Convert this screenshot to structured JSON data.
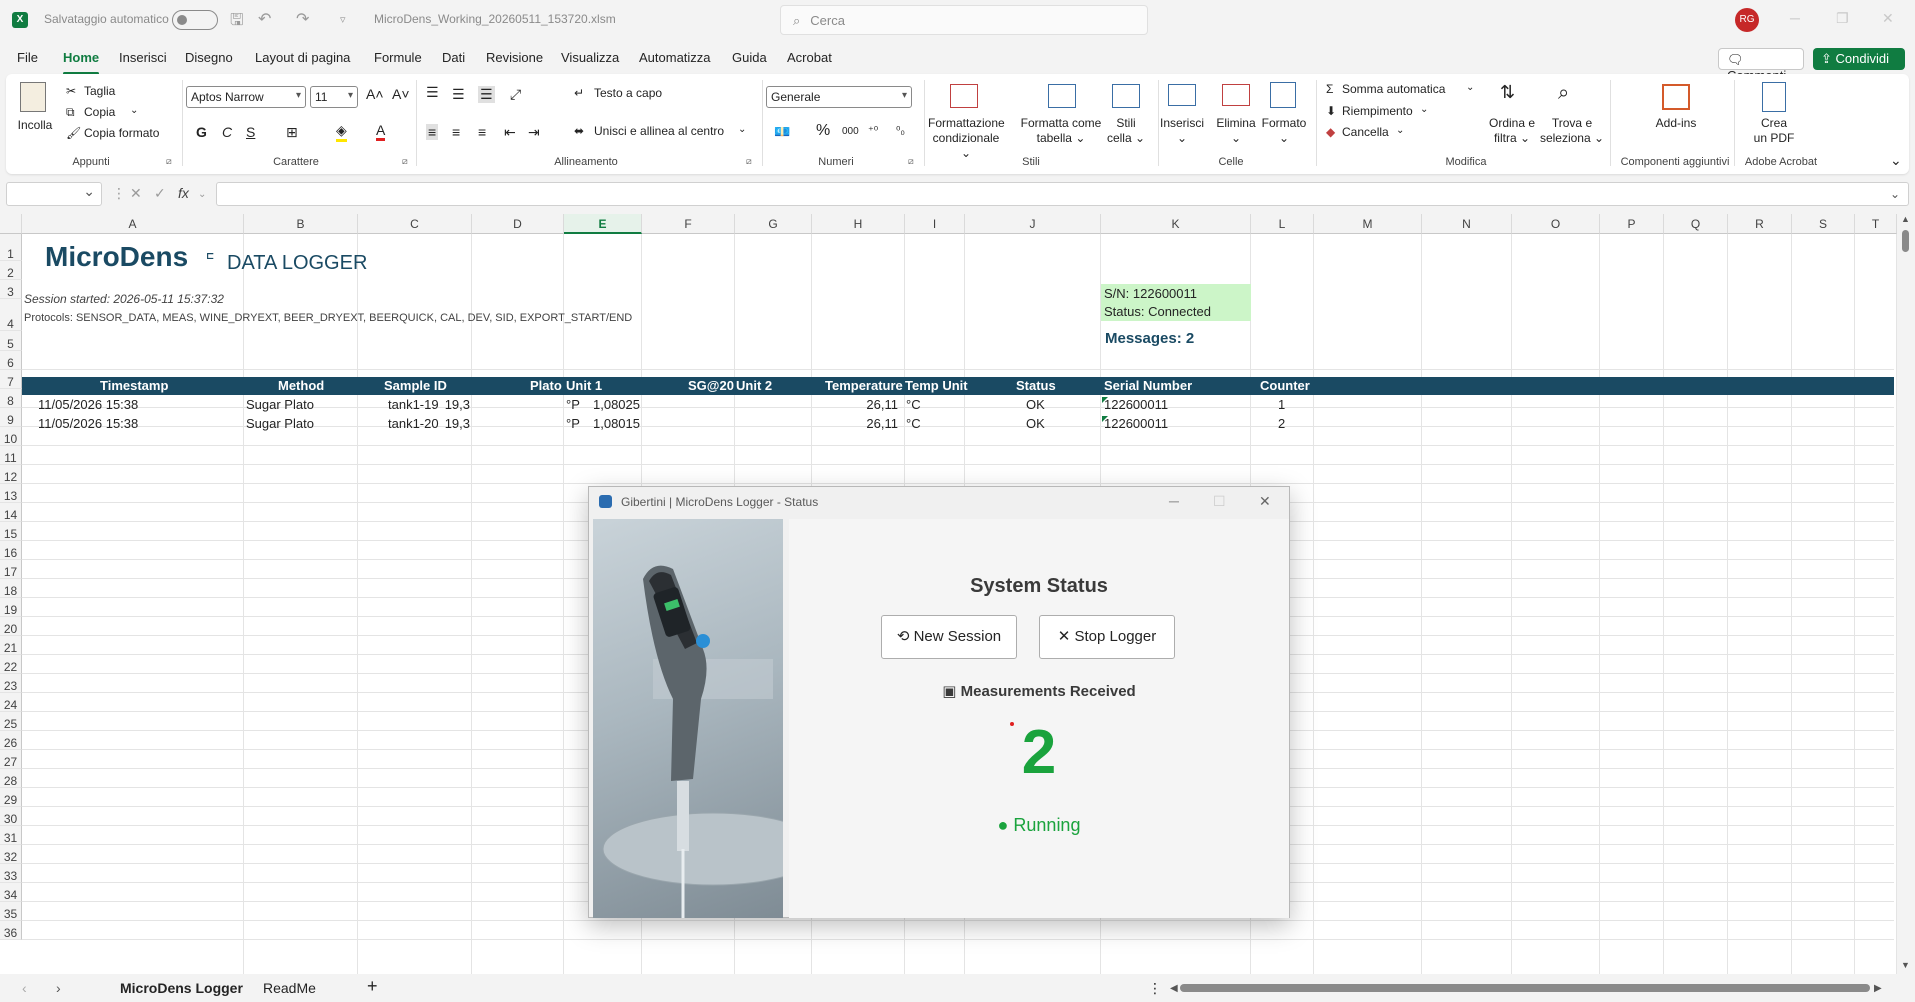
{
  "titlebar": {
    "autosave_label": "Salvataggio automatico",
    "filename": "MicroDens_Working_20260511_153720.xlsm",
    "search_placeholder": "Cerca",
    "avatar_initials": "RG"
  },
  "menu": {
    "items": [
      "File",
      "Home",
      "Inserisci",
      "Disegno",
      "Layout di pagina",
      "Formule",
      "Dati",
      "Revisione",
      "Visualizza",
      "Automatizza",
      "Guida",
      "Acrobat"
    ],
    "comments": "Commenti",
    "share": "Condividi"
  },
  "ribbon": {
    "paste": "Incolla",
    "cut": "Taglia",
    "copy": "Copia",
    "format_painter": "Copia formato",
    "group_clipboard": "Appunti",
    "font_name": "Aptos Narrow",
    "font_size": "11",
    "bold": "G",
    "italic": "C",
    "underline": "S",
    "group_font": "Carattere",
    "wrap_text": "Testo a capo",
    "merge_center": "Unisci e allinea al centro",
    "group_alignment": "Allineamento",
    "number_format": "Generale",
    "group_number": "Numeri",
    "cond_format_1": "Formattazione",
    "cond_format_2": "condizionale",
    "format_table_1": "Formatta come",
    "format_table_2": "tabella",
    "cell_styles_1": "Stili",
    "cell_styles_2": "cella",
    "group_styles": "Stili",
    "insert": "Inserisci",
    "delete": "Elimina",
    "format": "Formato",
    "group_cells": "Celle",
    "autosum": "Somma automatica",
    "fill": "Riempimento",
    "clear": "Cancella",
    "sort_filter_1": "Ordina e",
    "sort_filter_2": "filtra",
    "find_select_1": "Trova e",
    "find_select_2": "seleziona",
    "group_editing": "Modifica",
    "addins": "Add-ins",
    "group_addins": "Componenti aggiuntivi",
    "create_pdf_1": "Crea",
    "create_pdf_2": "un PDF",
    "group_acrobat": "Adobe Acrobat"
  },
  "grid": {
    "columns": [
      "A",
      "B",
      "C",
      "D",
      "E",
      "F",
      "G",
      "H",
      "I",
      "J",
      "K",
      "L",
      "M",
      "N",
      "O",
      "P",
      "Q",
      "R",
      "S",
      "T"
    ],
    "rows": [
      "1",
      "2",
      "3",
      "4",
      "5",
      "6",
      "7",
      "8",
      "9",
      "10",
      "11",
      "12",
      "13",
      "14",
      "15",
      "16",
      "17",
      "18",
      "19",
      "20",
      "21",
      "22",
      "23",
      "24",
      "25",
      "26",
      "27",
      "28",
      "29",
      "30",
      "31",
      "32",
      "33",
      "34",
      "35",
      "36"
    ],
    "logo_main": "MicroDens",
    "logo_sub": "DATA LOGGER",
    "session_started": "Session started: 2026-05-11 15:37:32",
    "protocols": "Protocols: SENSOR_DATA, MEAS, WINE_DRYEXT, BEER_DRYEXT, BEERQUICK, CAL, DEV, SID, EXPORT_START/END",
    "serial_info": "S/N: 122600011",
    "status_info": "Status: Connected",
    "messages": "Messages: 2",
    "headers": [
      "Timestamp",
      "Method",
      "Sample ID",
      "Plato",
      "Unit 1",
      "SG@20",
      "Unit 2",
      "Temperature",
      "Temp Unit",
      "Status",
      "Serial Number",
      "Counter"
    ],
    "data_rows": [
      [
        "11/05/2026 15:38",
        "Sugar Plato",
        "tank1-19",
        "19,3",
        "°P",
        "1,08025",
        "",
        "26,11",
        "°C",
        "OK",
        "122600011",
        "1"
      ],
      [
        "11/05/2026 15:38",
        "Sugar Plato",
        "tank1-20",
        "19,3",
        "°P",
        "1,08015",
        "",
        "26,11",
        "°C",
        "OK",
        "122600011",
        "2"
      ]
    ]
  },
  "sheets": {
    "tab1": "MicroDens Logger",
    "tab2": "ReadMe"
  },
  "dialog": {
    "title": "Gibertini | MicroDens Logger - Status",
    "heading": "System Status",
    "new_session": "New Session",
    "stop_logger": "Stop Logger",
    "measurements_label": "Measurements Received",
    "count": "2",
    "state": "Running"
  },
  "colors": {
    "excel_green": "#107c41",
    "header_band": "#1a4a63",
    "status_fill": "#ccf5c8",
    "running_green": "#1aa33d"
  }
}
